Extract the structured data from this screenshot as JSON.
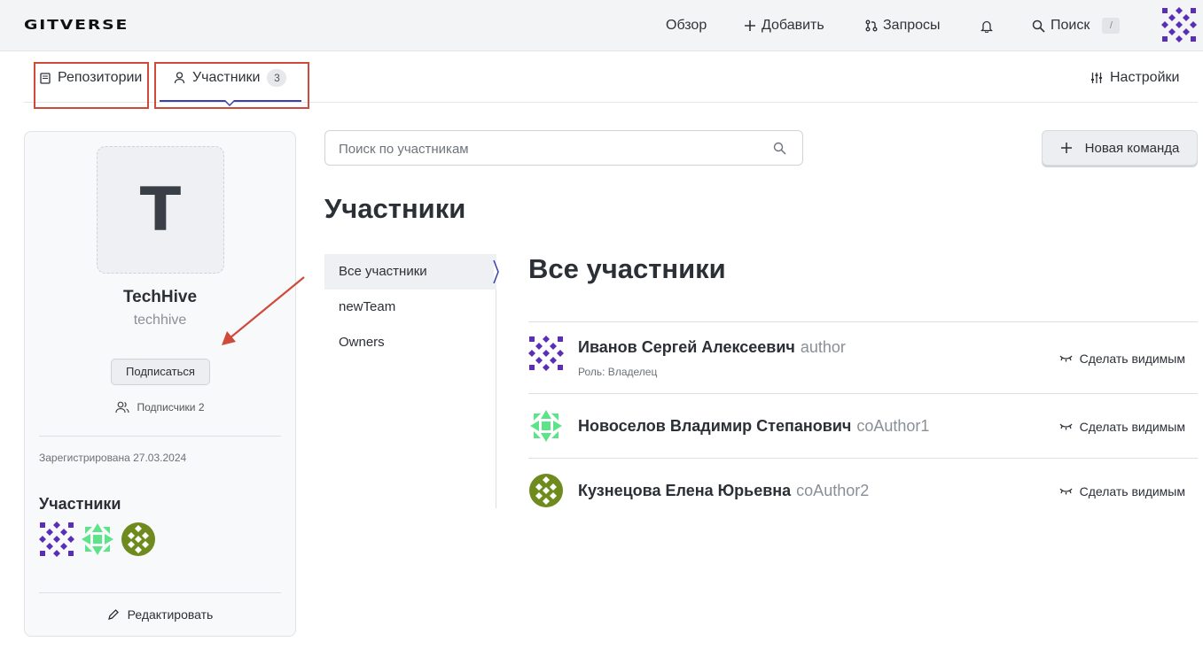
{
  "header": {
    "logo": "GITVERSE",
    "nav": {
      "overview": "Обзор",
      "add": "Добавить",
      "requests": "Запросы",
      "search": "Поиск",
      "search_shortcut": "/"
    }
  },
  "tabs": [
    {
      "label": "Репозитории",
      "icon": "repository-icon"
    },
    {
      "label": "Участники",
      "icon": "person-icon",
      "count": "3",
      "active": true
    }
  ],
  "settings_label": "Настройки",
  "org": {
    "initial": "T",
    "name": "TechHive",
    "slug": "techhive",
    "follow_label": "Подписаться",
    "followers_label": "Подписчики 2",
    "registered": "Зарегистрирована 27.03.2024",
    "members_title": "Участники",
    "edit_label": "Редактировать"
  },
  "search": {
    "placeholder": "Поиск по участникам"
  },
  "new_team_label": "Новая команда",
  "members_title": "Участники",
  "teams_menu": [
    {
      "label": "Все участники",
      "active": true
    },
    {
      "label": "newTeam"
    },
    {
      "label": "Owners"
    }
  ],
  "section_title": "Все участники",
  "members": [
    {
      "name": "Иванов Сергей Алексеевич",
      "login": "author",
      "role": "Роль: Владелец",
      "action": "Сделать видимым",
      "avatar_color": "#5b2fb5"
    },
    {
      "name": "Новоселов Владимир Степанович",
      "login": "coAuthor1",
      "role": "",
      "action": "Сделать видимым",
      "avatar_color": "#5ee38a"
    },
    {
      "name": "Кузнецова Елена Юрьевна",
      "login": "coAuthor2",
      "role": "",
      "action": "Сделать видимым",
      "avatar_color": "#6f8a1d"
    }
  ],
  "colors": {
    "accent": "#3b3fb0",
    "annotation": "#cf4a3b"
  }
}
